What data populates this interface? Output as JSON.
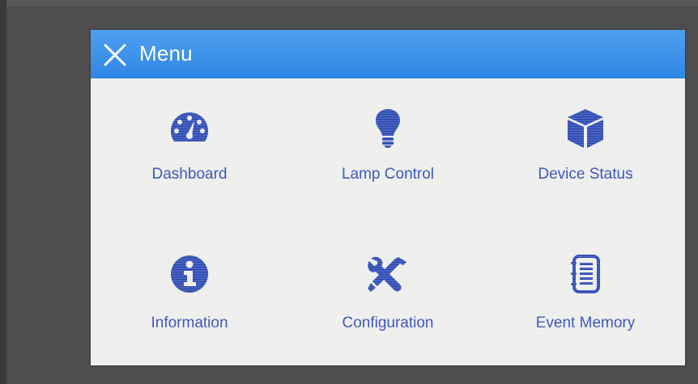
{
  "header": {
    "title": "Menu",
    "close_icon": "close-icon",
    "background_color": "#2f86e4"
  },
  "menu": {
    "accent_color": "#1f3fb0",
    "items": [
      {
        "label": "Dashboard",
        "icon": "gauge-icon"
      },
      {
        "label": "Lamp Control",
        "icon": "lightbulb-icon"
      },
      {
        "label": "Device Status",
        "icon": "cube-icon"
      },
      {
        "label": "Information",
        "icon": "info-circle-icon"
      },
      {
        "label": "Configuration",
        "icon": "tools-icon"
      },
      {
        "label": "Event Memory",
        "icon": "notebook-icon"
      }
    ]
  }
}
